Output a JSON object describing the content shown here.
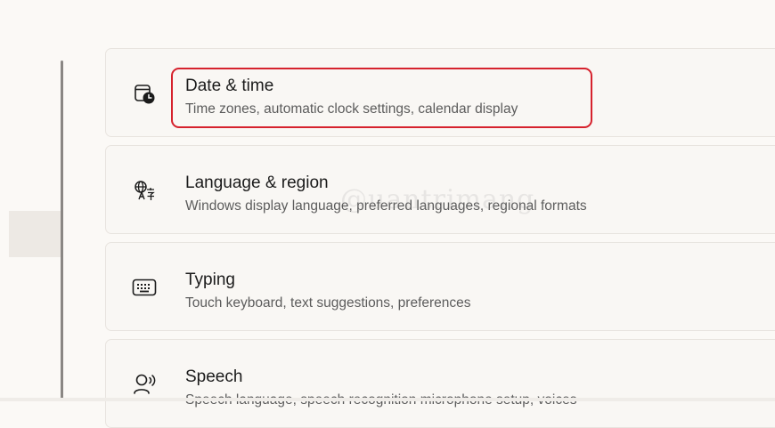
{
  "settings": {
    "items": [
      {
        "title": "Date & time",
        "subtitle": "Time zones, automatic clock settings, calendar display",
        "icon": "calendar-clock-icon"
      },
      {
        "title": "Language & region",
        "subtitle": "Windows display language, preferred languages, regional formats",
        "icon": "language-icon"
      },
      {
        "title": "Typing",
        "subtitle": "Touch keyboard, text suggestions, preferences",
        "icon": "keyboard-icon"
      },
      {
        "title": "Speech",
        "subtitle": "Speech language, speech recognition microphone setup, voices",
        "icon": "speech-icon"
      }
    ]
  },
  "annotation": {
    "highlight_color": "#d6222d"
  },
  "watermark": {
    "text": "@uantrimang"
  }
}
